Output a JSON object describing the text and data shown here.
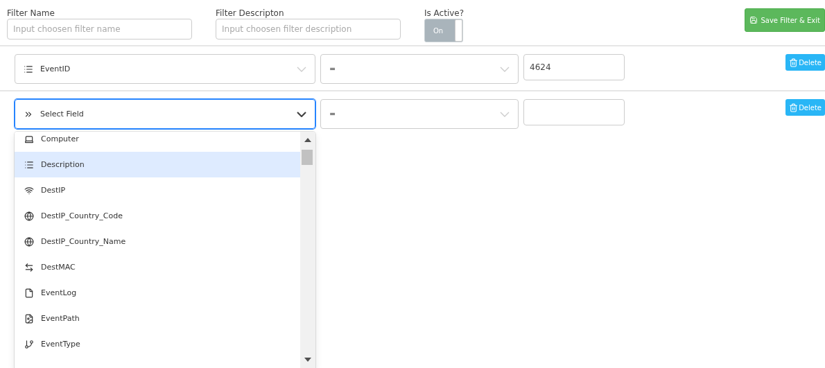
{
  "filter_name": {
    "label": "Filter Name",
    "placeholder": "Input choosen filter name"
  },
  "filter_description": {
    "label": "Filter Descripton",
    "placeholder": "Input choosen filter description"
  },
  "is_active": {
    "label": "Is Active?",
    "toggle_text": "On",
    "on": true
  },
  "save_button": "Save Filter & Exit",
  "conditions": [
    {
      "field": {
        "value": "EventID",
        "kind": "list"
      },
      "operator": "=",
      "value": "4624",
      "focused": false,
      "open": false,
      "delete_button": "Delete"
    },
    {
      "field": {
        "kind": "select"
      },
      "placeholder": "Select Field",
      "operator": "=",
      "focused": true,
      "open": true,
      "delete_button": "Delete"
    }
  ],
  "field_options": [
    {
      "label": "Computer",
      "kind": "computer",
      "selected": false
    },
    {
      "label": "Description",
      "kind": "list",
      "selected": true
    },
    {
      "label": "DestIP",
      "kind": "wifi",
      "selected": false
    },
    {
      "label": "DestIP_Country_Code",
      "kind": "globe",
      "selected": false
    },
    {
      "label": "DestIP_Country_Name",
      "kind": "globe",
      "selected": false
    },
    {
      "label": "DestMAC",
      "kind": "exchange",
      "selected": false
    },
    {
      "label": "EventLog",
      "kind": "file",
      "selected": false
    },
    {
      "label": "EventPath",
      "kind": "file-image",
      "selected": false
    },
    {
      "label": "EventType",
      "kind": "branch",
      "selected": false
    }
  ]
}
